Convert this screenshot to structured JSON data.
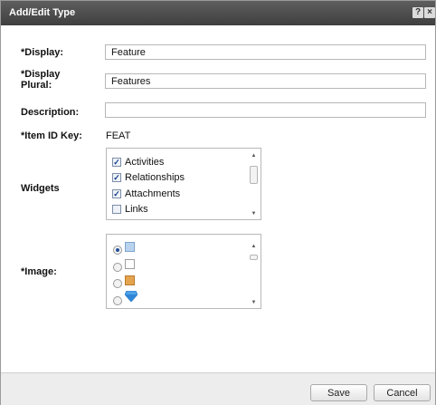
{
  "dialog": {
    "title": "Add/Edit Type",
    "help_glyph": "?",
    "close_glyph": "×"
  },
  "form": {
    "display_label": "*Display:",
    "display_value": "Feature",
    "display_plural_label_line1": "*Display",
    "display_plural_label_line2": "Plural:",
    "display_plural_value": "Features",
    "description_label": "Description:",
    "description_value": "",
    "item_id_key_label": "*Item ID Key:",
    "item_id_key_value": "FEAT",
    "widgets_label": "Widgets",
    "image_label": "*Image:"
  },
  "widgets": [
    {
      "label": "Activities",
      "checked": true
    },
    {
      "label": "Relationships",
      "checked": true
    },
    {
      "label": "Attachments",
      "checked": true
    },
    {
      "label": "Links",
      "checked": false
    }
  ],
  "images": [
    {
      "icon": "blue-document-icon",
      "selected": true
    },
    {
      "icon": "white-document-icon",
      "selected": false
    },
    {
      "icon": "orange-folder-icon",
      "selected": false
    },
    {
      "icon": "blue-diamond-icon",
      "selected": false
    }
  ],
  "footer": {
    "save_label": "Save",
    "cancel_label": "Cancel"
  },
  "colors": {
    "titlebar": "#4b4b4b",
    "footer": "#ededed",
    "checkmark": "#123e8a"
  }
}
